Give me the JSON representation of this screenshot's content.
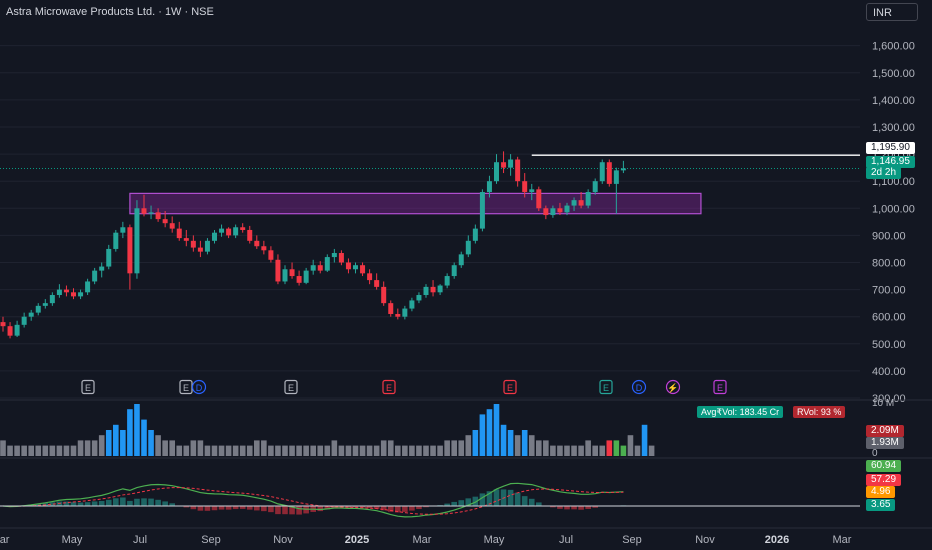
{
  "header": {
    "title": "Astra Microwave Products Ltd. · 1W · NSE",
    "currency_button": "INR"
  },
  "price_labels": {
    "resistance": "1,195.90",
    "last": "1,146.95",
    "countdown": "2d 2h"
  },
  "volume_labels": {
    "avg": "Avg₹Vol: 183.45 Cr",
    "rvol": "RVol: 93 %",
    "top_tick": "10 M",
    "zero_tick": "0",
    "v1": "2.09M",
    "v2": "1.93M"
  },
  "macd_labels": {
    "a": "60.94",
    "b": "57.29",
    "c": "4.96",
    "d": "3.65"
  },
  "colors": {
    "background": "#131722",
    "up": "#26a69a",
    "down": "#f23645",
    "zone": "#9c27b0",
    "volume_blue": "#2196f3",
    "volume_gray": "#787b86",
    "macd_line": "#4caf50",
    "signal_line": "#f23645",
    "last_price": "#089981"
  },
  "event_markers": [
    {
      "label": "E",
      "kind": "earnings"
    },
    {
      "label": "E",
      "kind": "earnings"
    },
    {
      "label": "D",
      "kind": "dividend"
    },
    {
      "label": "E",
      "kind": "earnings"
    },
    {
      "label": "E",
      "kind": "earnings-down"
    },
    {
      "label": "E",
      "kind": "earnings-down"
    },
    {
      "label": "E",
      "kind": "earnings-up"
    },
    {
      "label": "D",
      "kind": "dividend"
    },
    {
      "label": "⚡",
      "kind": "split"
    },
    {
      "label": "E",
      "kind": "earnings-future"
    }
  ],
  "chart_data": {
    "type": "candlestick",
    "title": "Astra Microwave Products Ltd. · 1W · NSE",
    "currency": "INR",
    "y_ticks": [
      "1,600.00",
      "1,500.00",
      "1,400.00",
      "1,300.00",
      "1,200.00",
      "1,100.00",
      "1,000.00",
      "900.00",
      "800.00",
      "700.00",
      "600.00",
      "500.00",
      "400.00",
      "300.00"
    ],
    "y_range": [
      300,
      1680
    ],
    "x_ticks": [
      "Mar",
      "May",
      "Jul",
      "Sep",
      "Nov",
      "2025",
      "Mar",
      "May",
      "Jul",
      "Sep",
      "Nov",
      "2026",
      "Mar"
    ],
    "last_price": 1146.95,
    "resistance_level": 1195.9,
    "demand_zone": {
      "low": 980,
      "high": 1055,
      "from_week": 18,
      "to_week": 99
    },
    "weeks_visible": 101,
    "candles_ohlc": [
      [
        580,
        600,
        545,
        565
      ],
      [
        565,
        580,
        520,
        530
      ],
      [
        530,
        585,
        525,
        570
      ],
      [
        570,
        615,
        560,
        600
      ],
      [
        600,
        625,
        585,
        615
      ],
      [
        615,
        650,
        605,
        640
      ],
      [
        640,
        665,
        630,
        650
      ],
      [
        650,
        690,
        640,
        680
      ],
      [
        680,
        720,
        670,
        700
      ],
      [
        700,
        715,
        675,
        690
      ],
      [
        690,
        705,
        665,
        675
      ],
      [
        675,
        700,
        665,
        690
      ],
      [
        690,
        740,
        680,
        730
      ],
      [
        730,
        780,
        720,
        770
      ],
      [
        770,
        800,
        745,
        785
      ],
      [
        785,
        865,
        775,
        850
      ],
      [
        850,
        920,
        840,
        910
      ],
      [
        910,
        950,
        890,
        930
      ],
      [
        930,
        940,
        700,
        760
      ],
      [
        760,
        1030,
        740,
        1000
      ],
      [
        1000,
        1050,
        970,
        980
      ],
      [
        980,
        1010,
        960,
        985
      ],
      [
        985,
        1000,
        950,
        960
      ],
      [
        960,
        990,
        930,
        945
      ],
      [
        945,
        970,
        910,
        925
      ],
      [
        925,
        950,
        880,
        890
      ],
      [
        890,
        920,
        860,
        880
      ],
      [
        880,
        900,
        840,
        855
      ],
      [
        855,
        880,
        820,
        840
      ],
      [
        840,
        890,
        830,
        880
      ],
      [
        880,
        920,
        870,
        910
      ],
      [
        910,
        940,
        895,
        925
      ],
      [
        925,
        930,
        890,
        900
      ],
      [
        900,
        940,
        890,
        930
      ],
      [
        930,
        945,
        910,
        920
      ],
      [
        920,
        935,
        870,
        880
      ],
      [
        880,
        900,
        850,
        860
      ],
      [
        860,
        880,
        830,
        845
      ],
      [
        845,
        860,
        800,
        810
      ],
      [
        810,
        830,
        720,
        730
      ],
      [
        730,
        790,
        720,
        775
      ],
      [
        775,
        800,
        740,
        750
      ],
      [
        750,
        770,
        715,
        725
      ],
      [
        725,
        780,
        720,
        770
      ],
      [
        770,
        810,
        755,
        790
      ],
      [
        790,
        805,
        760,
        770
      ],
      [
        770,
        830,
        765,
        820
      ],
      [
        820,
        850,
        800,
        835
      ],
      [
        835,
        845,
        790,
        800
      ],
      [
        800,
        815,
        760,
        775
      ],
      [
        775,
        800,
        760,
        790
      ],
      [
        790,
        800,
        750,
        760
      ],
      [
        760,
        775,
        720,
        735
      ],
      [
        735,
        760,
        700,
        710
      ],
      [
        710,
        730,
        640,
        650
      ],
      [
        650,
        660,
        600,
        610
      ],
      [
        610,
        630,
        590,
        600
      ],
      [
        600,
        640,
        590,
        630
      ],
      [
        630,
        670,
        620,
        660
      ],
      [
        660,
        690,
        650,
        680
      ],
      [
        680,
        720,
        670,
        710
      ],
      [
        710,
        735,
        675,
        690
      ],
      [
        690,
        720,
        680,
        715
      ],
      [
        715,
        760,
        705,
        750
      ],
      [
        750,
        800,
        740,
        790
      ],
      [
        790,
        840,
        780,
        830
      ],
      [
        830,
        900,
        820,
        880
      ],
      [
        880,
        940,
        870,
        925
      ],
      [
        925,
        1070,
        915,
        1060
      ],
      [
        1060,
        1120,
        1040,
        1100
      ],
      [
        1100,
        1200,
        1090,
        1170
      ],
      [
        1170,
        1210,
        1130,
        1150
      ],
      [
        1150,
        1200,
        1120,
        1180
      ],
      [
        1180,
        1190,
        1080,
        1100
      ],
      [
        1100,
        1130,
        1040,
        1060
      ],
      [
        1060,
        1090,
        1030,
        1070
      ],
      [
        1070,
        1080,
        990,
        1000
      ],
      [
        1000,
        1010,
        960,
        975
      ],
      [
        975,
        1010,
        965,
        1000
      ],
      [
        1000,
        1020,
        975,
        985
      ],
      [
        985,
        1020,
        975,
        1010
      ],
      [
        1010,
        1040,
        990,
        1030
      ],
      [
        1030,
        1060,
        1000,
        1010
      ],
      [
        1010,
        1070,
        1000,
        1060
      ],
      [
        1060,
        1110,
        1050,
        1100
      ],
      [
        1100,
        1180,
        1090,
        1170
      ],
      [
        1170,
        1180,
        1080,
        1090
      ],
      [
        1090,
        1150,
        980,
        1140
      ],
      [
        1140,
        1175,
        1130,
        1147
      ]
    ],
    "volume": [
      3,
      2,
      2,
      2,
      2,
      2,
      2,
      2,
      2,
      2,
      2,
      3,
      3,
      3,
      4,
      5,
      6,
      5,
      9,
      10,
      7,
      5,
      4,
      3,
      3,
      2,
      2,
      3,
      3,
      2,
      2,
      2,
      2,
      2,
      2,
      2,
      3,
      3,
      2,
      2,
      2,
      2,
      2,
      2,
      2,
      2,
      2,
      3,
      2,
      2,
      2,
      2,
      2,
      2,
      3,
      3,
      2,
      2,
      2,
      2,
      2,
      2,
      2,
      3,
      3,
      3,
      4,
      5,
      8,
      9,
      10,
      6,
      5,
      4,
      5,
      4,
      3,
      3,
      2,
      2,
      2,
      2,
      2,
      3,
      2,
      2,
      3,
      3,
      2,
      4,
      2,
      6,
      2
    ],
    "macd": {
      "macd_line_label": "60.94",
      "signal_line_label": "57.29",
      "histogram_label": "4.96",
      "zero_label": "3.65"
    }
  }
}
